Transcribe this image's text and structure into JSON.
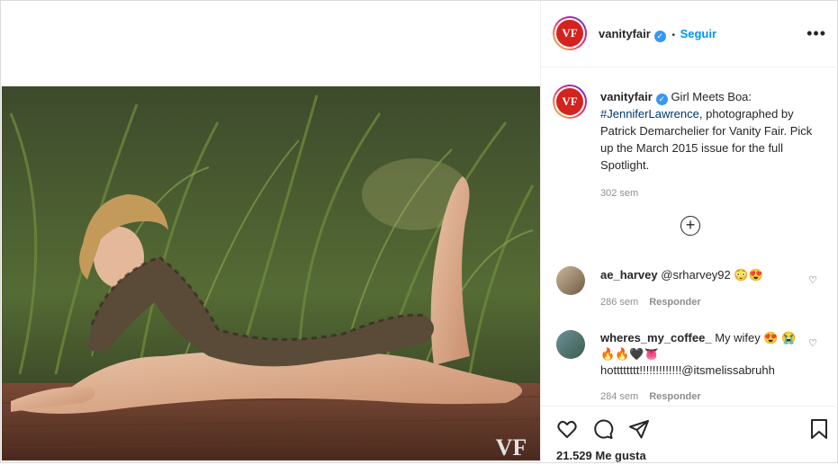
{
  "account": {
    "username": "vanityfair",
    "avatar_text": "VF",
    "verified_icon": "verified-badge-icon",
    "dot_separator": "•",
    "follow_label": "Seguir",
    "more_icon": "more-options-icon"
  },
  "post": {
    "watermark": "VF",
    "caption_before": "Girl Meets Boa:",
    "caption_hashtag": "#JenniferLawrence",
    "caption_after": ", photographed by Patrick Demarchelier for Vanity Fair. Pick up the March 2015 issue for the full Spotlight.",
    "time": "302 sem",
    "load_more_symbol": "+",
    "likes": "21.529 Me gusta"
  },
  "comments": [
    {
      "username": "ae_harvey",
      "text": "@srharvey92 😳😍",
      "time": "286 sem",
      "reply_label": "Responder"
    },
    {
      "username": "wheres_my_coffee_",
      "text": "My wifey 😍 😭🔥🔥🖤👅 hotttttttt!!!!!!!!!!!!!@itsmelissabruhh",
      "time": "284 sem",
      "reply_label": "Responder"
    }
  ],
  "actions": {
    "like_icon": "heart-icon",
    "comment_icon": "comment-icon",
    "share_icon": "share-icon",
    "save_icon": "bookmark-icon"
  },
  "colors": {
    "brand_red": "#d4221e",
    "link_blue": "#0095f6",
    "verified_blue": "#3897f0",
    "hashtag": "#00376b"
  }
}
